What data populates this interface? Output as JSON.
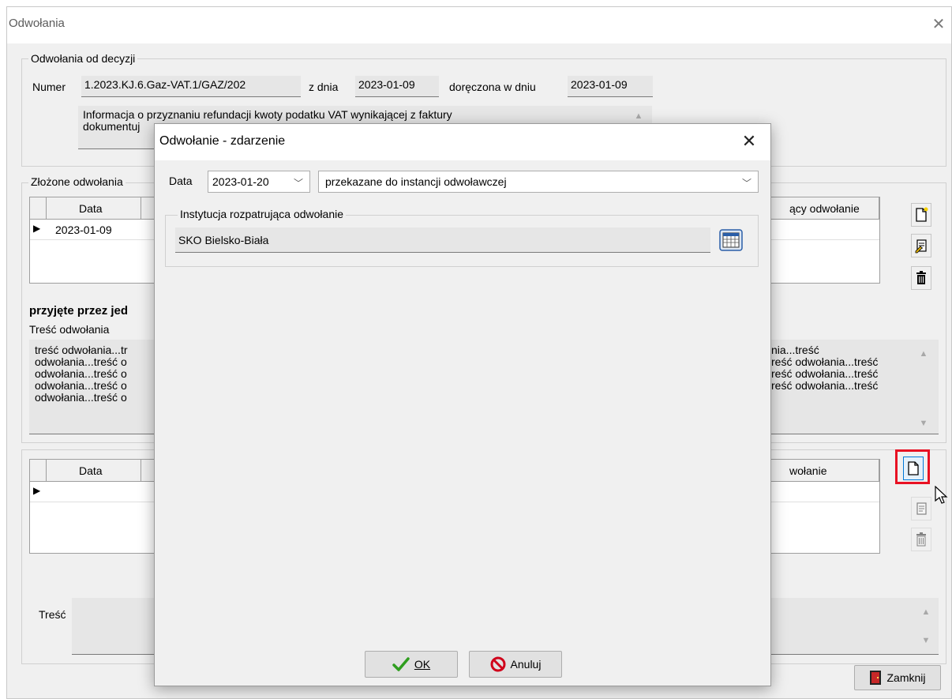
{
  "main": {
    "title": "Odwołania",
    "appeals_group_label": "Odwołania od decyzji",
    "numer_label": "Numer",
    "numer_value": "1.2023.KJ.6.Gaz-VAT.1/GAZ/202",
    "z_dnia_label": "z dnia",
    "z_dnia_value": "2023-01-09",
    "doreczona_label": "doręczona w dniu",
    "doreczona_value": "2023-01-09",
    "info_line1": "Informacja o przyznaniu refundacji kwoty podatku VAT wynikającej z faktury",
    "info_line2": "dokumentuj",
    "zlozone_label": "Złożone odwołania",
    "grid1": {
      "col_data": "Data",
      "col_right": "ący odwołanie",
      "row1_date": "2023-01-09"
    },
    "przyjete_label": "przyjęte przez jed",
    "tresc_odwolania_label": "Treść odwołania",
    "tresc_left": [
      "treść odwołania...tr",
      "odwołania...treść o",
      "odwołania...treść o",
      "odwołania...treść o",
      "odwołania...treść o"
    ],
    "tresc_right": [
      "nia...treść",
      "reść odwołania...treść",
      "reść odwołania...treść",
      "reść odwołania...treść"
    ],
    "grid2": {
      "col_data": "Data",
      "col_right": "wołanie"
    },
    "tresc_label": "Treść",
    "zamknij_label": "Zamknij"
  },
  "dialog": {
    "title": "Odwołanie - zdarzenie",
    "data_label": "Data",
    "data_value": "2023-01-20",
    "status_value": "przekazane do instancji odwoławczej",
    "institution_group_label": "Instytucja rozpatrująca odwołanie",
    "institution_value": "SKO Bielsko-Biała",
    "ok_label": "OK",
    "cancel_label": "Anuluj"
  },
  "icons": [
    "close-icon",
    "chevron-down-icon",
    "calendar-icon",
    "new-document-icon",
    "edit-document-icon",
    "trash-icon",
    "checkmark-icon",
    "cancel-icon",
    "door-exit-icon",
    "row-pointer-icon",
    "scroll-up-icon",
    "scroll-down-icon",
    "mouse-cursor-icon"
  ],
  "colors": {
    "highlight": "#e81123",
    "ok_check": "#2f9e1f",
    "cancel_red": "#d0021b"
  }
}
